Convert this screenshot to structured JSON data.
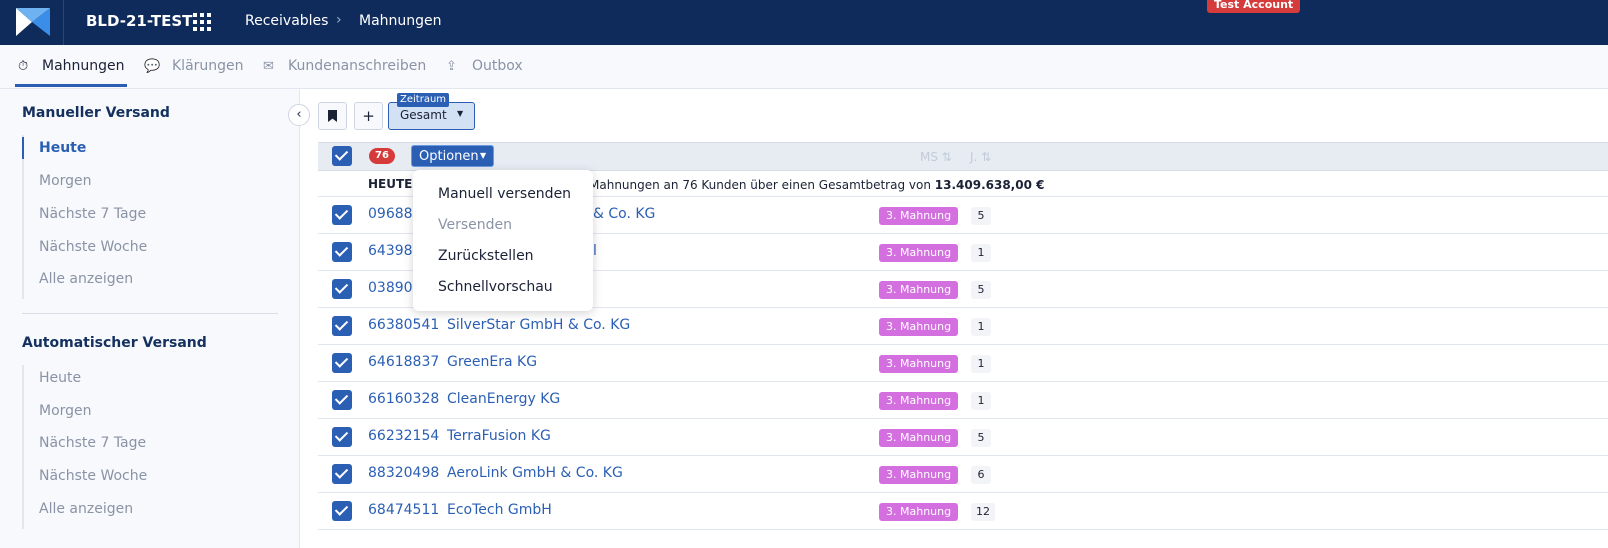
{
  "header": {
    "app_title": "BLD-21-TEST",
    "breadcrumb": [
      "Receivables",
      "Mahnungen"
    ],
    "account_badge": "Test Account"
  },
  "tabs": [
    {
      "label": "Mahnungen",
      "icon": "stopwatch-icon",
      "active": true
    },
    {
      "label": "Klärungen",
      "icon": "chat-icon",
      "active": false
    },
    {
      "label": "Kundenanschreiben",
      "icon": "mail-tray-icon",
      "active": false
    },
    {
      "label": "Outbox",
      "icon": "outbox-icon",
      "active": false
    }
  ],
  "sidebar": {
    "manual": {
      "title": "Manueller Versand",
      "items": [
        "Heute",
        "Morgen",
        "Nächste 7 Tage",
        "Nächste Woche",
        "Alle anzeigen"
      ],
      "active_index": 0
    },
    "auto": {
      "title": "Automatischer Versand",
      "items": [
        "Heute",
        "Morgen",
        "Nächste 7 Tage",
        "Nächste Woche",
        "Alle anzeigen"
      ]
    }
  },
  "toolbar": {
    "add_label": "+",
    "zeitraum_label": "Zeitraum",
    "zeitraum_value": "Gesamt"
  },
  "table": {
    "selected_count": "76",
    "options_label": "Optionen",
    "header_cols": {
      "ms": "MS",
      "j": "J."
    },
    "summary_label": "HEUTE",
    "summary_prefix": "Mahnungen an 76 Kunden über einen Gesamtbetrag von ",
    "summary_amount": "13.409.638,00 €",
    "rows": [
      {
        "num": "09688",
        "name": "& Co. KG",
        "stage": "3. Mahnung",
        "count": "5"
      },
      {
        "num": "64398",
        "name": "l",
        "stage": "3. Mahnung",
        "count": "1"
      },
      {
        "num": "03890",
        "name": "",
        "stage": "3. Mahnung",
        "count": "5"
      },
      {
        "num": "66380541",
        "name": "SilverStar GmbH & Co. KG",
        "stage": "3. Mahnung",
        "count": "1"
      },
      {
        "num": "64618837",
        "name": "GreenEra KG",
        "stage": "3. Mahnung",
        "count": "1"
      },
      {
        "num": "66160328",
        "name": "CleanEnergy KG",
        "stage": "3. Mahnung",
        "count": "1"
      },
      {
        "num": "66232154",
        "name": "TerraFusion KG",
        "stage": "3. Mahnung",
        "count": "5"
      },
      {
        "num": "88320498",
        "name": "AeroLink GmbH & Co. KG",
        "stage": "3. Mahnung",
        "count": "6"
      },
      {
        "num": "68474511",
        "name": "EcoTech GmbH",
        "stage": "3. Mahnung",
        "count": "12"
      }
    ]
  },
  "dropdown": {
    "items": [
      {
        "label": "Manuell versenden",
        "disabled": false
      },
      {
        "label": "Versenden",
        "disabled": true
      },
      {
        "label": "Zurückstellen",
        "disabled": false
      },
      {
        "label": "Schnellvorschau",
        "disabled": false
      }
    ]
  },
  "colors": {
    "topbar": "#0f2b5b",
    "accent": "#2b5fb4",
    "stage_badge": "#d46fe0",
    "alert_badge": "#d63b3b"
  }
}
